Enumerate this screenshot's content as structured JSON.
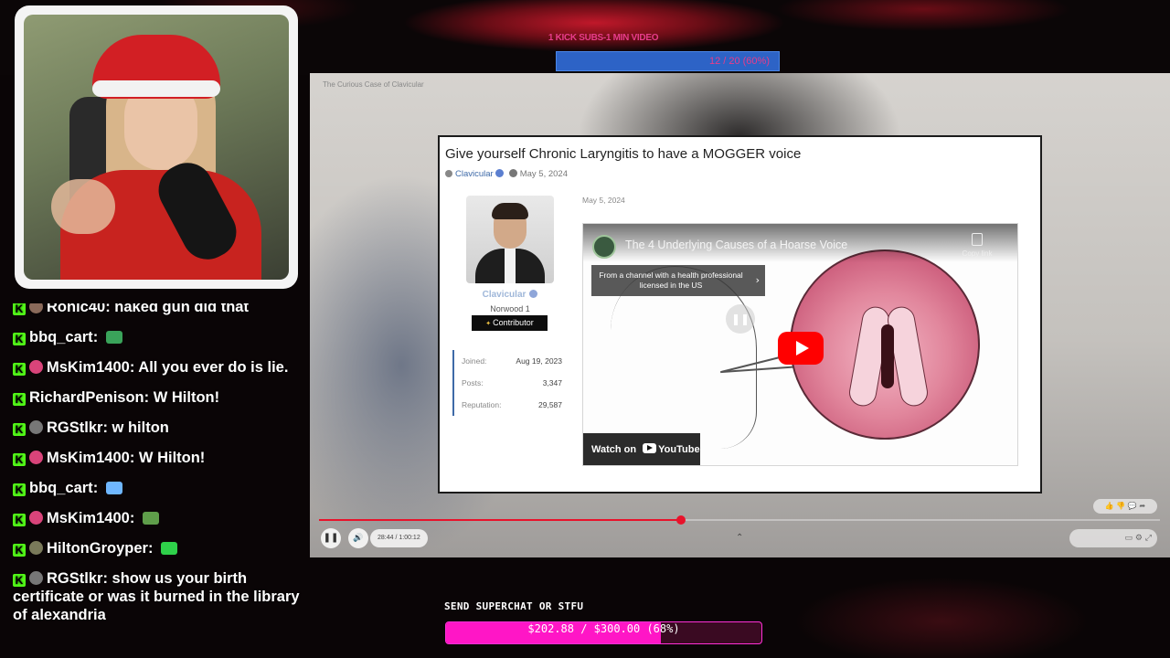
{
  "overlay": {
    "sub_goal_label": "1 KICK SUBS-1 MIN VIDEO",
    "sub_goal_progress": "12 / 20 (60%)",
    "sub_goal_fraction": 0.6,
    "superchat_label": "SEND SUPERCHAT OR STFU",
    "superchat_progress": "$202.88 / $300.00 (68%)",
    "superchat_fraction": 0.68,
    "accent_pink": "#ff16c6",
    "kick_green": "#53fc18"
  },
  "chat": {
    "messages": [
      {
        "user": "Ronic40",
        "text": "naked gun did that",
        "avatar_color": "#8a6a5a",
        "cut": true
      },
      {
        "user": "bbq_cart",
        "text": "",
        "avatar_color": "",
        "emote": "emote-green-car"
      },
      {
        "user": "MsKim1400",
        "text": "All you ever do is lie.",
        "avatar_color": "#d9447a"
      },
      {
        "user": "RichardPenison",
        "text": "W Hilton!",
        "avatar_color": ""
      },
      {
        "user": "RGStlkr",
        "text": "w hilton",
        "avatar_color": "#777"
      },
      {
        "user": "MsKim1400",
        "text": "W Hilton!",
        "avatar_color": "#d9447a"
      },
      {
        "user": "bbq_cart",
        "text": "",
        "avatar_color": "",
        "emote": "emote-diamond"
      },
      {
        "user": "MsKim1400",
        "text": "",
        "avatar_color": "#d9447a",
        "emote": "emote-pepe"
      },
      {
        "user": "HiltonGroyper",
        "text": "",
        "avatar_color": "#7a7a5a",
        "emote": "emote-green-heart"
      },
      {
        "user": "RGStlkr",
        "text": "show us your birth certificate or was it burned in the library of alexandria",
        "avatar_color": "#777"
      }
    ]
  },
  "video": {
    "tiny_title": "The Curious Case of Clavicular",
    "time": "28:44 / 1:00:12",
    "progress_fraction": 0.43
  },
  "forum": {
    "title": "Give yourself Chronic Laryngitis to have a MOGGER voice",
    "author": "Clavicular",
    "date": "May 5, 2024",
    "post_date": "May 5, 2024",
    "profile_name": "Clavicular",
    "profile_sub": "Norwood 1",
    "role": "Contributor",
    "stats": [
      {
        "label": "Joined:",
        "value": "Aug 19, 2023"
      },
      {
        "label": "Posts:",
        "value": "3,347"
      },
      {
        "label": "Reputation:",
        "value": "29,587"
      }
    ]
  },
  "youtube": {
    "title": "The 4 Underlying Causes of a Hoarse Voice",
    "copy_link": "Copy link",
    "info_box": "From a channel with a health professional licensed in the US",
    "watch_on": "Watch on",
    "yt_word": "YouTube"
  }
}
